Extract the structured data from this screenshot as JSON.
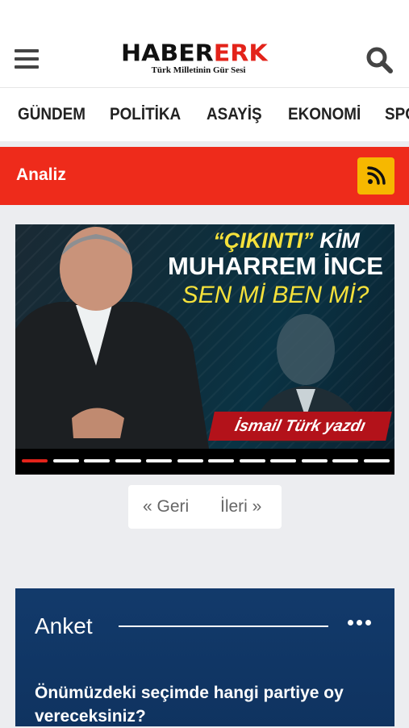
{
  "header": {
    "logo_black": "HABER",
    "logo_red": "ERK",
    "tagline": "Türk Milletinin Gür Sesi"
  },
  "nav": {
    "items": [
      "GÜNDEM",
      "POLİTİKA",
      "ASAYİŞ",
      "EKONOMİ",
      "SPO"
    ]
  },
  "section": {
    "title": "Analiz"
  },
  "slider": {
    "headline_quote": "“ÇIKINTI”",
    "headline_kim": " KİM",
    "headline_name": "MUHARREM İNCE",
    "headline_question": "SEN Mİ BEN Mİ?",
    "caption": "İsmail Türk yazdı",
    "slide_count": 12,
    "active_index": 0
  },
  "pager": {
    "prev": "« Geri",
    "next": "İleri »"
  },
  "poll": {
    "title": "Anket",
    "question": "Önümüzdeki seçimde hangi partiye oy vereceksiniz?"
  },
  "colors": {
    "brand_red": "#e3231a",
    "section_bar": "#ee2b1b",
    "rss_yellow": "#f6b800",
    "poll_blue": "#123a6b"
  }
}
